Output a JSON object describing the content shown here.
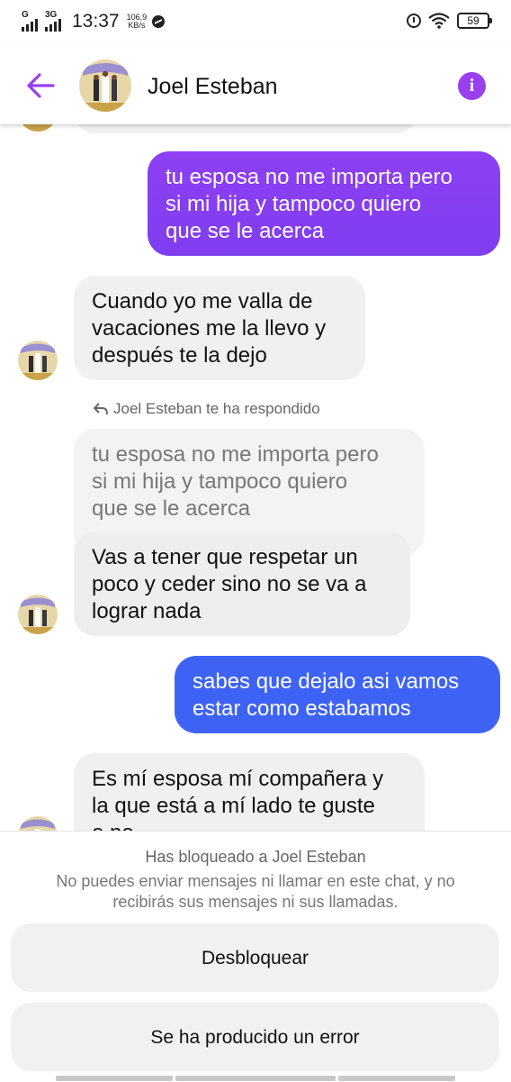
{
  "status_bar": {
    "network_1": "G",
    "network_2": "3G",
    "time": "13:37",
    "speed_value": "106,9",
    "speed_unit": "KB/s",
    "battery": "59"
  },
  "header": {
    "contact_name": "Joel Esteban"
  },
  "conversation": {
    "msg_out_1": [
      "tu esposa no me importa pero",
      "si mi hija y tampoco quiero",
      "que se le acerca"
    ],
    "msg_in_1": [
      "Cuando yo me valla de",
      "vacaciones me la llevo y",
      "después te la dejo"
    ],
    "reply_label": "Joel Esteban te ha respondido",
    "quoted": [
      "tu esposa no me importa pero",
      "si mi hija y tampoco quiero",
      "que se le acerca"
    ],
    "msg_in_2": [
      "Vas a tener que respetar un",
      "poco y ceder sino no se va a",
      "lograr nada"
    ],
    "msg_out_2": [
      "sabes que dejalo asi vamos",
      "estar como estabamos"
    ],
    "msg_in_3": [
      "Es mí esposa mí compañera y",
      "la que está a mí lado te guste",
      "o no"
    ]
  },
  "blocked": {
    "title": "Has bloqueado a Joel Esteban",
    "description": "No puedes enviar mensajes ni llamar en este chat, y no recibirás sus mensajes ni sus llamadas.",
    "unblock_label": "Desbloquear",
    "error_label": "Se ha producido un error"
  },
  "colors": {
    "accent": "#9a3ff0",
    "outgoing_purple": "#8b3ef0",
    "outgoing_blue": "#3e63f4",
    "incoming_bg": "#f0f0f0"
  }
}
